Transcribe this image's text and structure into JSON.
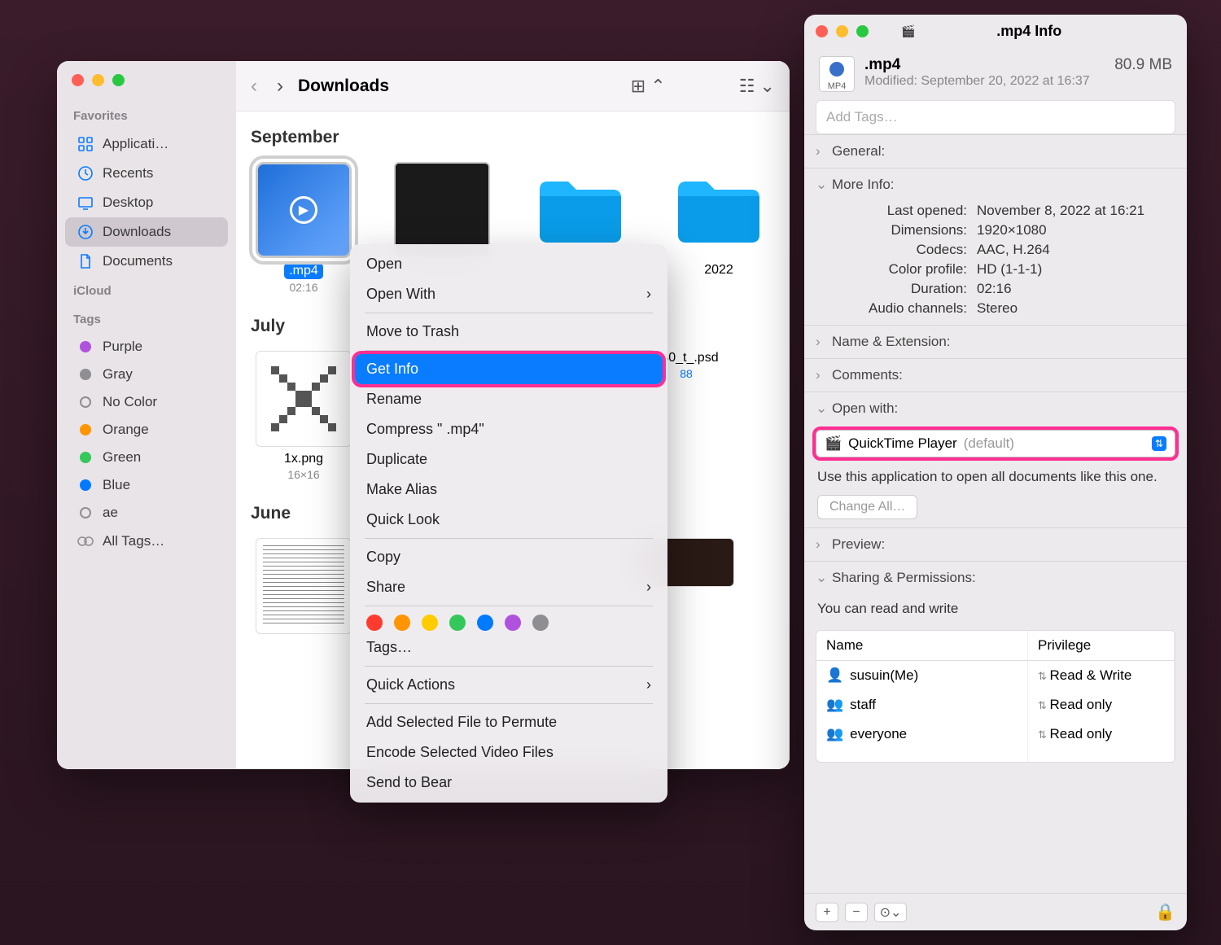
{
  "finder": {
    "title": "Downloads",
    "sidebar": {
      "favorites_label": "Favorites",
      "icloud_label": "iCloud",
      "tags_label": "Tags",
      "items": [
        {
          "label": "Applicati…"
        },
        {
          "label": "Recents"
        },
        {
          "label": "Desktop"
        },
        {
          "label": "Downloads"
        },
        {
          "label": "Documents"
        }
      ],
      "tags": [
        {
          "label": "Purple",
          "color": "#af52de"
        },
        {
          "label": "Gray",
          "color": "#8e8e93"
        },
        {
          "label": "No Color",
          "color": ""
        },
        {
          "label": "Orange",
          "color": "#ff9500"
        },
        {
          "label": "Green",
          "color": "#34c759"
        },
        {
          "label": "Blue",
          "color": "#007aff"
        },
        {
          "label": "ae",
          "color": ""
        },
        {
          "label": "All Tags…",
          "color": ""
        }
      ]
    },
    "groups": {
      "g1": "September",
      "g2": "July",
      "g3": "June"
    },
    "files": {
      "mp4": {
        "name": ".mp4",
        "meta": "02:16"
      },
      "png": {
        "name": "1x.png",
        "meta": "16×16"
      },
      "psd": {
        "name": "030_t_.psd",
        "meta": "88"
      },
      "folder2022": {
        "name": "2022"
      }
    }
  },
  "context_menu": {
    "open": "Open",
    "open_with": "Open With",
    "move_to_trash": "Move to Trash",
    "get_info": "Get Info",
    "rename": "Rename",
    "compress": "Compress \" .mp4\"",
    "duplicate": "Duplicate",
    "make_alias": "Make Alias",
    "quick_look": "Quick Look",
    "copy": "Copy",
    "share": "Share",
    "tags": "Tags…",
    "quick_actions": "Quick Actions",
    "add_permute": "Add Selected File to Permute",
    "encode_video": "Encode Selected Video Files",
    "send_bear": "Send to Bear",
    "tag_colors": [
      "#ff3b30",
      "#ff9500",
      "#ffcc00",
      "#34c759",
      "#007aff",
      "#af52de",
      "#8e8e93"
    ]
  },
  "info": {
    "title": ".mp4 Info",
    "name": ".mp4",
    "size": "80.9 MB",
    "modified": "Modified: September 20, 2022 at 16:37",
    "tags_placeholder": "Add Tags…",
    "sections": {
      "general": "General:",
      "more_info": "More Info:",
      "name_ext": "Name & Extension:",
      "comments": "Comments:",
      "open_with": "Open with:",
      "preview": "Preview:",
      "sharing": "Sharing & Permissions:"
    },
    "more_info": {
      "last_opened_k": "Last opened:",
      "last_opened_v": "November 8, 2022 at 16:21",
      "dimensions_k": "Dimensions:",
      "dimensions_v": "1920×1080",
      "codecs_k": "Codecs:",
      "codecs_v": "AAC, H.264",
      "color_profile_k": "Color profile:",
      "color_profile_v": "HD (1-1-1)",
      "duration_k": "Duration:",
      "duration_v": "02:16",
      "audio_k": "Audio channels:",
      "audio_v": "Stereo"
    },
    "open_with_app": "QuickTime Player",
    "open_with_suffix": "(default)",
    "open_with_hint": "Use this application to open all documents like this one.",
    "change_all": "Change All…",
    "perm_text": "You can read and write",
    "perm_headers": {
      "name": "Name",
      "priv": "Privilege"
    },
    "perm_rows": [
      {
        "name": "susuin(Me)",
        "priv": "Read & Write"
      },
      {
        "name": "staff",
        "priv": "Read only"
      },
      {
        "name": "everyone",
        "priv": "Read only"
      }
    ]
  }
}
